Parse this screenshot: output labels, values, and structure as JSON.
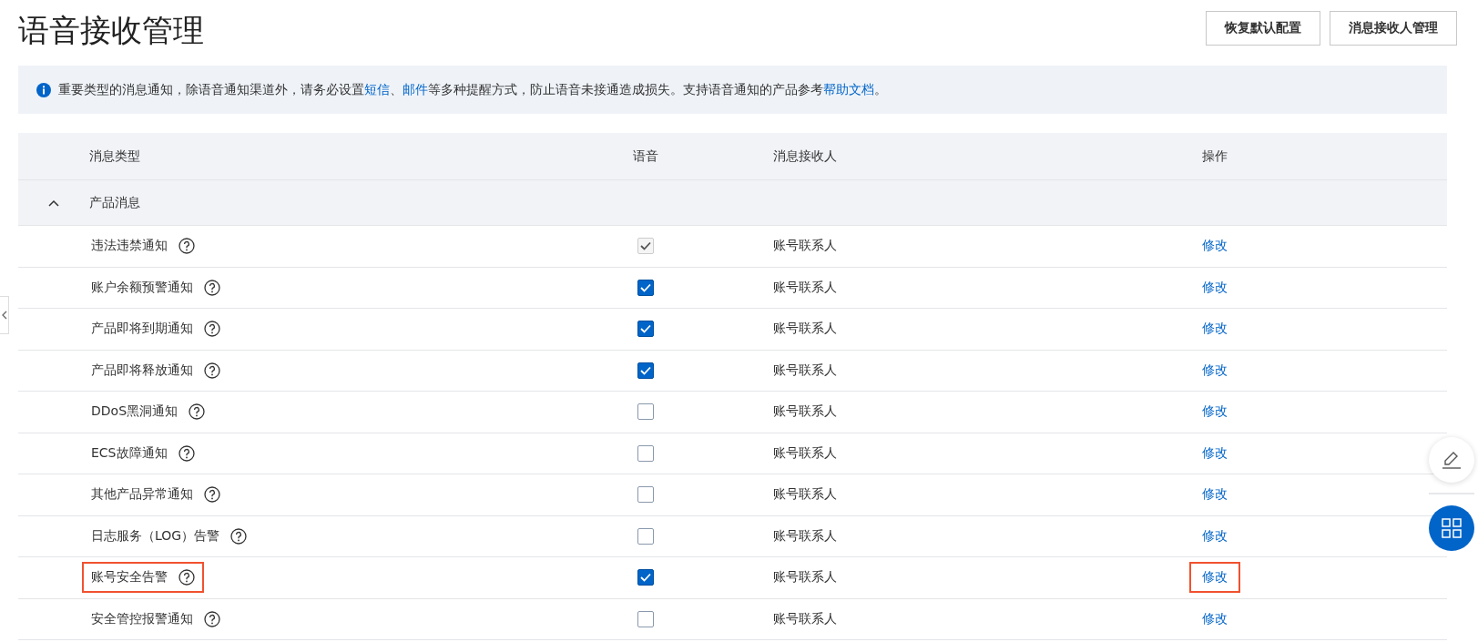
{
  "page_title": "语音接收管理",
  "header_buttons": [
    "恢复默认配置",
    "消息接收人管理"
  ],
  "notice": {
    "segments": [
      {
        "kind": "text",
        "text": "重要类型的消息通知，除语音通知渠道外，请务必设置"
      },
      {
        "kind": "link",
        "text": "短信"
      },
      {
        "kind": "text",
        "text": "、"
      },
      {
        "kind": "link",
        "text": "邮件"
      },
      {
        "kind": "text",
        "text": "等多种提醒方式，防止语音未接通造成损失。支持语音通知的产品参考"
      },
      {
        "kind": "link",
        "text": "帮助文档"
      },
      {
        "kind": "text",
        "text": "。"
      }
    ]
  },
  "table": {
    "columns": [
      "消息类型",
      "语音",
      "消息接收人",
      "操作"
    ],
    "group": {
      "name": "产品消息",
      "expanded": true
    },
    "rows": [
      {
        "name": "违法违禁通知",
        "voice_checked": true,
        "disabled": true,
        "recipient": "账号联系人",
        "action": "修改",
        "highlighted": false
      },
      {
        "name": "账户余额预警通知",
        "voice_checked": true,
        "disabled": false,
        "recipient": "账号联系人",
        "action": "修改",
        "highlighted": false
      },
      {
        "name": "产品即将到期通知",
        "voice_checked": true,
        "disabled": false,
        "recipient": "账号联系人",
        "action": "修改",
        "highlighted": false
      },
      {
        "name": "产品即将释放通知",
        "voice_checked": true,
        "disabled": false,
        "recipient": "账号联系人",
        "action": "修改",
        "highlighted": false
      },
      {
        "name": "DDoS黑洞通知",
        "voice_checked": false,
        "disabled": false,
        "recipient": "账号联系人",
        "action": "修改",
        "highlighted": false
      },
      {
        "name": "ECS故障通知",
        "voice_checked": false,
        "disabled": false,
        "recipient": "账号联系人",
        "action": "修改",
        "highlighted": false
      },
      {
        "name": "其他产品异常通知",
        "voice_checked": false,
        "disabled": false,
        "recipient": "账号联系人",
        "action": "修改",
        "highlighted": false
      },
      {
        "name": "日志服务（LOG）告警",
        "voice_checked": false,
        "disabled": false,
        "recipient": "账号联系人",
        "action": "修改",
        "highlighted": false
      },
      {
        "name": "账号安全告警",
        "voice_checked": true,
        "disabled": false,
        "recipient": "账号联系人",
        "action": "修改",
        "highlighted": true
      },
      {
        "name": "安全管控报警通知",
        "voice_checked": false,
        "disabled": false,
        "recipient": "账号联系人",
        "action": "修改",
        "highlighted": false
      }
    ]
  }
}
